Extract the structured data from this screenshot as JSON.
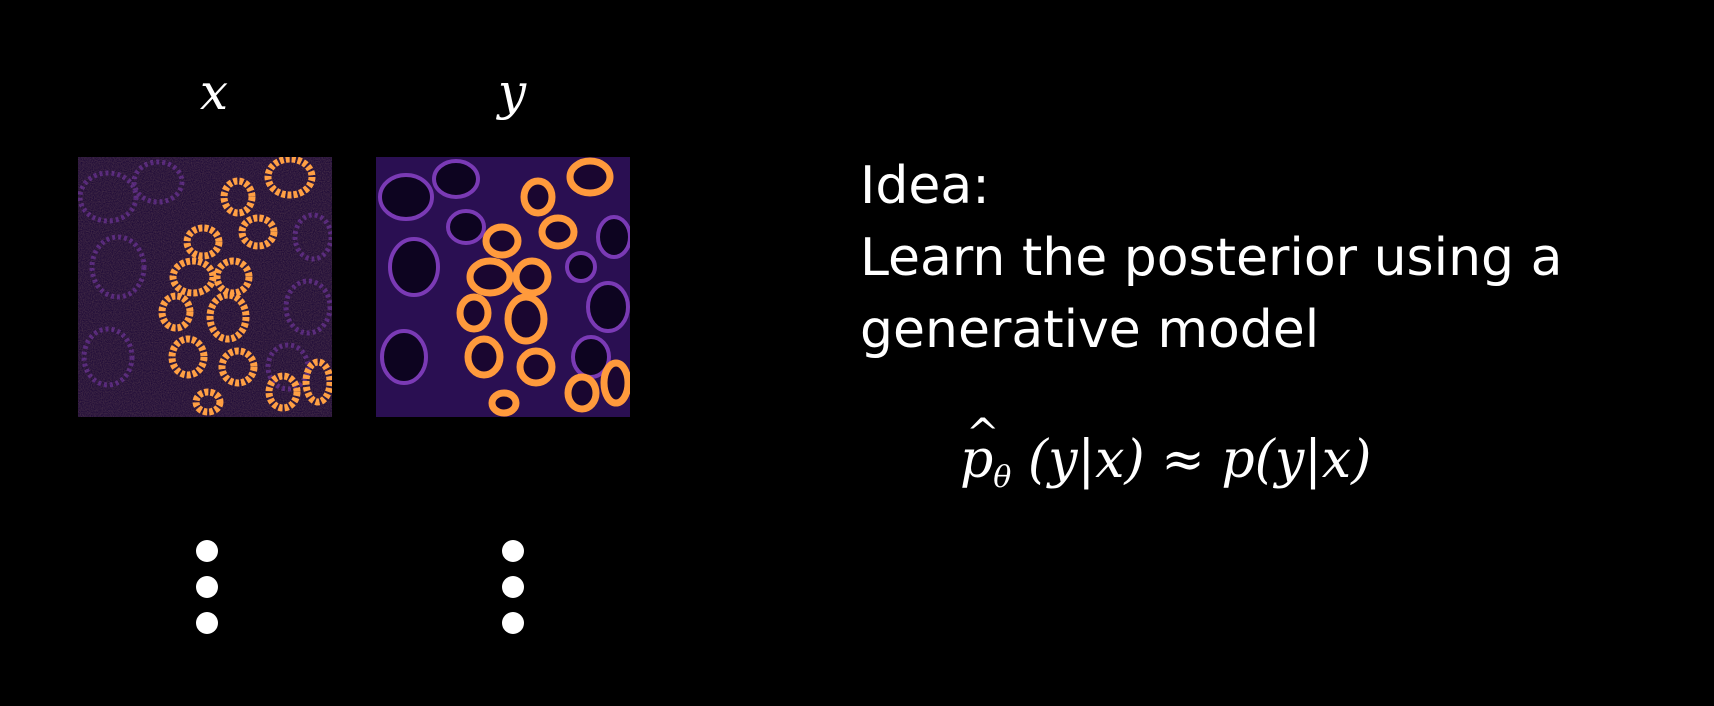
{
  "columns": [
    {
      "label": "x",
      "image": "noisy-micrograph"
    },
    {
      "label": "y",
      "image": "clean-micrograph"
    }
  ],
  "text": {
    "line1": "Idea:",
    "line2": "Learn the posterior using a",
    "line3": "generative model"
  },
  "formula": {
    "hat": "^",
    "p_hat": "p",
    "theta": "θ",
    "lhs_args": "(y|x)",
    "approx": "≈",
    "rhs": "p(y|x)"
  },
  "colors": {
    "background": "#000000",
    "text": "#ffffff",
    "cell_bright": "#ffa640",
    "cell_mid": "#c23a7c",
    "cell_dim": "#2d0f55"
  }
}
